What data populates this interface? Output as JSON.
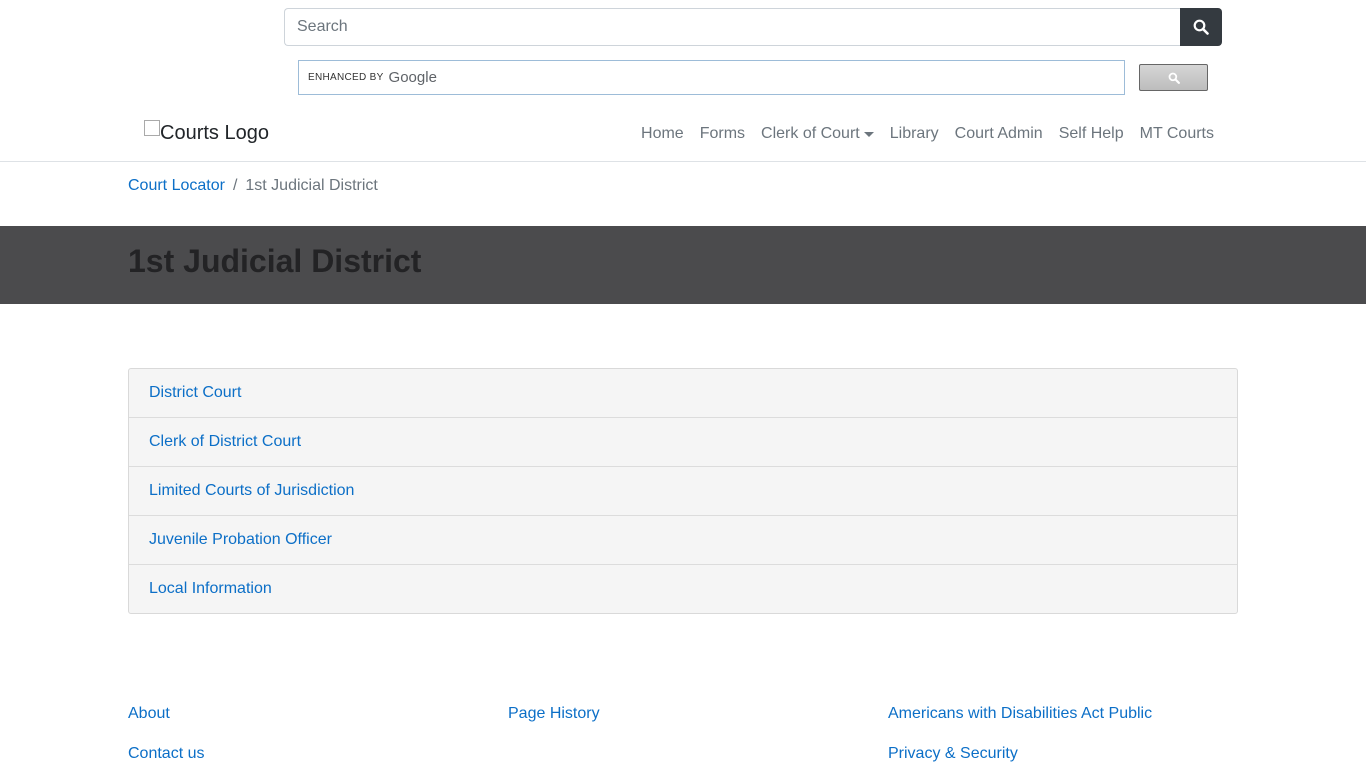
{
  "search": {
    "placeholder": "Search"
  },
  "google_search": {
    "enhanced_by": "ENHANCED BY",
    "brand": "Google"
  },
  "logo": {
    "alt": "Courts Logo"
  },
  "nav": {
    "items": [
      {
        "label": "Home"
      },
      {
        "label": "Forms"
      },
      {
        "label": "Clerk of Court"
      },
      {
        "label": "Library"
      },
      {
        "label": "Court Admin"
      },
      {
        "label": "Self Help"
      },
      {
        "label": "MT Courts"
      }
    ]
  },
  "breadcrumb": {
    "parent": "Court Locator",
    "separator": "/",
    "current": "1st Judicial District"
  },
  "page": {
    "title": "1st Judicial District"
  },
  "sections": [
    {
      "label": "District Court"
    },
    {
      "label": "Clerk of District Court"
    },
    {
      "label": "Limited Courts of Jurisdiction"
    },
    {
      "label": "Juvenile Probation Officer"
    },
    {
      "label": "Local Information"
    }
  ],
  "footer": {
    "about": "About",
    "contact": "Contact us",
    "page_history": "Page History",
    "ada": "Americans with Disabilities Act Public",
    "privacy": "Privacy & Security"
  },
  "colors": {
    "link": "#0c6fc7",
    "banner": "#4b4b4d",
    "search_button": "#343a40"
  }
}
